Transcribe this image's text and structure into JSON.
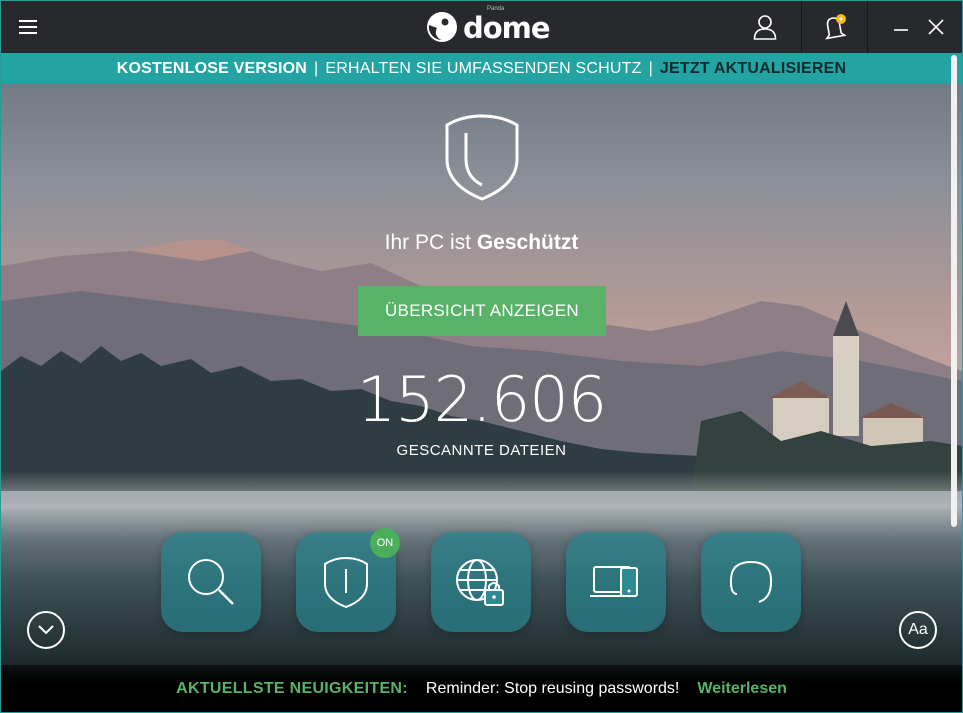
{
  "app": {
    "logo_text": "dome",
    "logo_small": "Panda"
  },
  "promo": {
    "free_version": "KOSTENLOSE VERSION",
    "separator": "|",
    "protection": "ERHALTEN SIE UMFASSENDEN SCHUTZ",
    "upgrade": "JETZT AKTUALISIEREN"
  },
  "status": {
    "prefix": "Ihr PC ist ",
    "state": "Geschützt",
    "overview_button": "ÜBERSICHT ANZEIGEN",
    "scanned_count": "152.606",
    "scanned_label": "GESCANNTE DATEIEN"
  },
  "tiles": {
    "antivirus_badge": "ON"
  },
  "font_button": "Aa",
  "news": {
    "label": "AKTUELLSTE NEUIGKEITEN:",
    "text": "Reminder: Stop reusing passwords!",
    "link": "Weiterlesen"
  },
  "colors": {
    "titlebar": "#27292d",
    "promo": "#23a3a2",
    "accent_green": "#58b368",
    "tile": "#28828c"
  }
}
